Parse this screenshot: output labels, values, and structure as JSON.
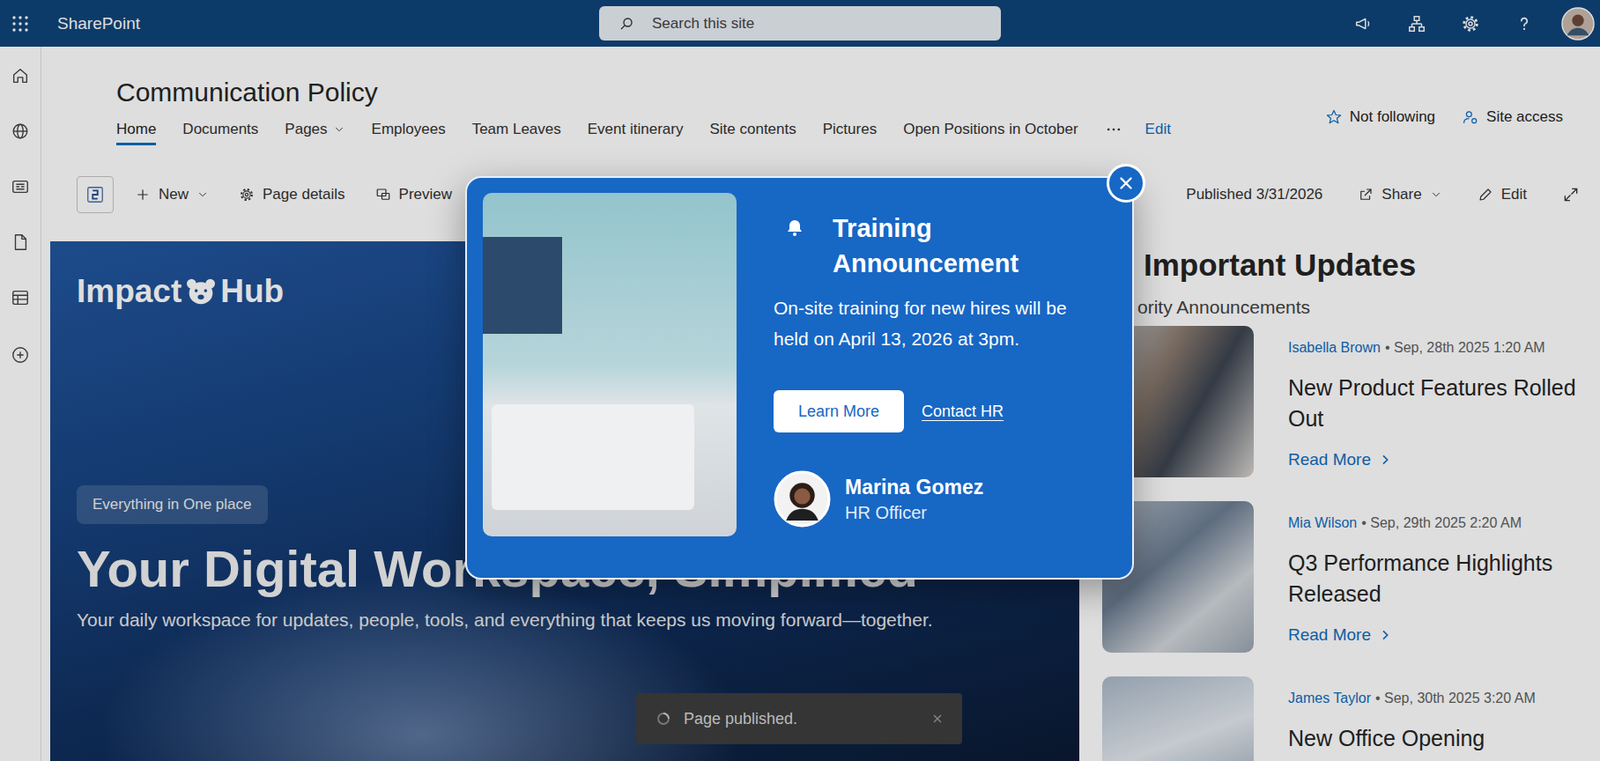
{
  "suite_bar": {
    "app": "SharePoint",
    "search_placeholder": "Search this site"
  },
  "site": {
    "title": "Communication Policy",
    "nav": [
      {
        "label": "Home",
        "selected": true,
        "has_menu": false
      },
      {
        "label": "Documents",
        "selected": false,
        "has_menu": false
      },
      {
        "label": "Pages",
        "selected": false,
        "has_menu": true
      },
      {
        "label": "Employees",
        "selected": false,
        "has_menu": false
      },
      {
        "label": "Team Leaves",
        "selected": false,
        "has_menu": false
      },
      {
        "label": "Event itinerary",
        "selected": false,
        "has_menu": false
      },
      {
        "label": "Site contents",
        "selected": false,
        "has_menu": false
      },
      {
        "label": "Pictures",
        "selected": false,
        "has_menu": false
      },
      {
        "label": "Open Positions in October",
        "selected": false,
        "has_menu": false
      }
    ],
    "edit_link": "Edit",
    "follow": {
      "label": "Not following",
      "following": false
    },
    "site_access": "Site access"
  },
  "command_bar": {
    "new": "New",
    "page_details": "Page details",
    "preview": "Preview",
    "status": "Published 3/31/2026",
    "share": "Share",
    "edit": "Edit"
  },
  "hero": {
    "logo_left": "Impact",
    "logo_right": "Hub",
    "tag": "Everything in One place",
    "title": "Your Digital Workspace, Simplified",
    "description": "Your daily workspace for updates, people, tools, and everything that keeps us moving forward—together."
  },
  "updates": {
    "title": "Important Updates",
    "subtitle": "ority Announcements",
    "cards": [
      {
        "author": "Isabella Brown",
        "date": "• Sep, 28th 2025 1:20 AM",
        "title": "New Product Features Rolled Out",
        "read_more": "Read More"
      },
      {
        "author": "Mia Wilson",
        "date": "• Sep, 29th 2025 2:20 AM",
        "title": "Q3 Performance Highlights Released",
        "read_more": "Read More"
      },
      {
        "author": "James Taylor",
        "date": "• Sep, 30th 2025 3:20 AM",
        "title": "New Office Opening"
      }
    ]
  },
  "modal": {
    "title": "Training Announcement",
    "body": "On-site training for new hires will be held on April 13, 2026 at 3pm.",
    "primary": "Learn More",
    "secondary": "Contact HR",
    "contact": {
      "name": "Marina Gomez",
      "role": "HR Officer"
    }
  },
  "toast": {
    "text": "Page published."
  }
}
